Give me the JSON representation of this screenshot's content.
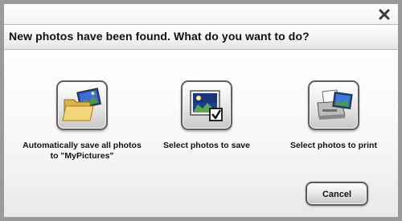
{
  "dialog": {
    "close_icon": "close-icon",
    "header": "New photos have been found. What do you want to do?",
    "options": [
      {
        "label": "Automatically save all photos to \"MyPictures\"",
        "icon": "folder-photo-icon"
      },
      {
        "label": "Select photos to save",
        "icon": "photo-checkbox-icon"
      },
      {
        "label": "Select photos to print",
        "icon": "printer-photo-icon"
      }
    ],
    "cancel_label": "Cancel"
  }
}
